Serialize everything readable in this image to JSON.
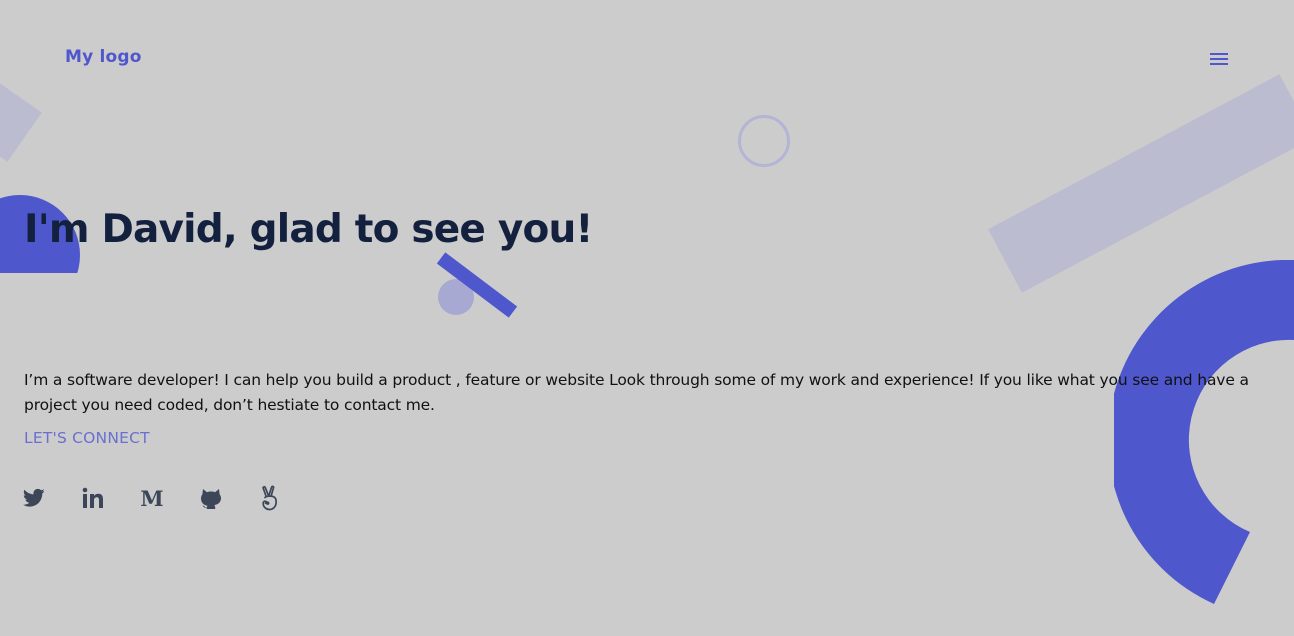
{
  "header": {
    "logo_text": "My logo",
    "menu_icon": "hamburger-menu-icon"
  },
  "hero": {
    "headline": "I'm David, glad to see you!",
    "bio": "I’m a software developer! I can help you build a product , feature or website Look through some of my work and experience! If you like what you see and have a project you need coded, don’t hestiate to contact me.",
    "connect_label": "LET'S CONNECT"
  },
  "social_links": [
    {
      "icon": "twitter-icon"
    },
    {
      "icon": "linkedin-icon",
      "glyph": "in"
    },
    {
      "icon": "medium-icon",
      "glyph": "M"
    },
    {
      "icon": "github-icon"
    },
    {
      "icon": "angellist-icon"
    }
  ],
  "colors": {
    "background": "#cccccc",
    "accent": "#4f57cc",
    "link": "#6a70cf",
    "headline": "#13213f",
    "icon": "#3d4559",
    "deco_light": "#bcbcd0"
  }
}
